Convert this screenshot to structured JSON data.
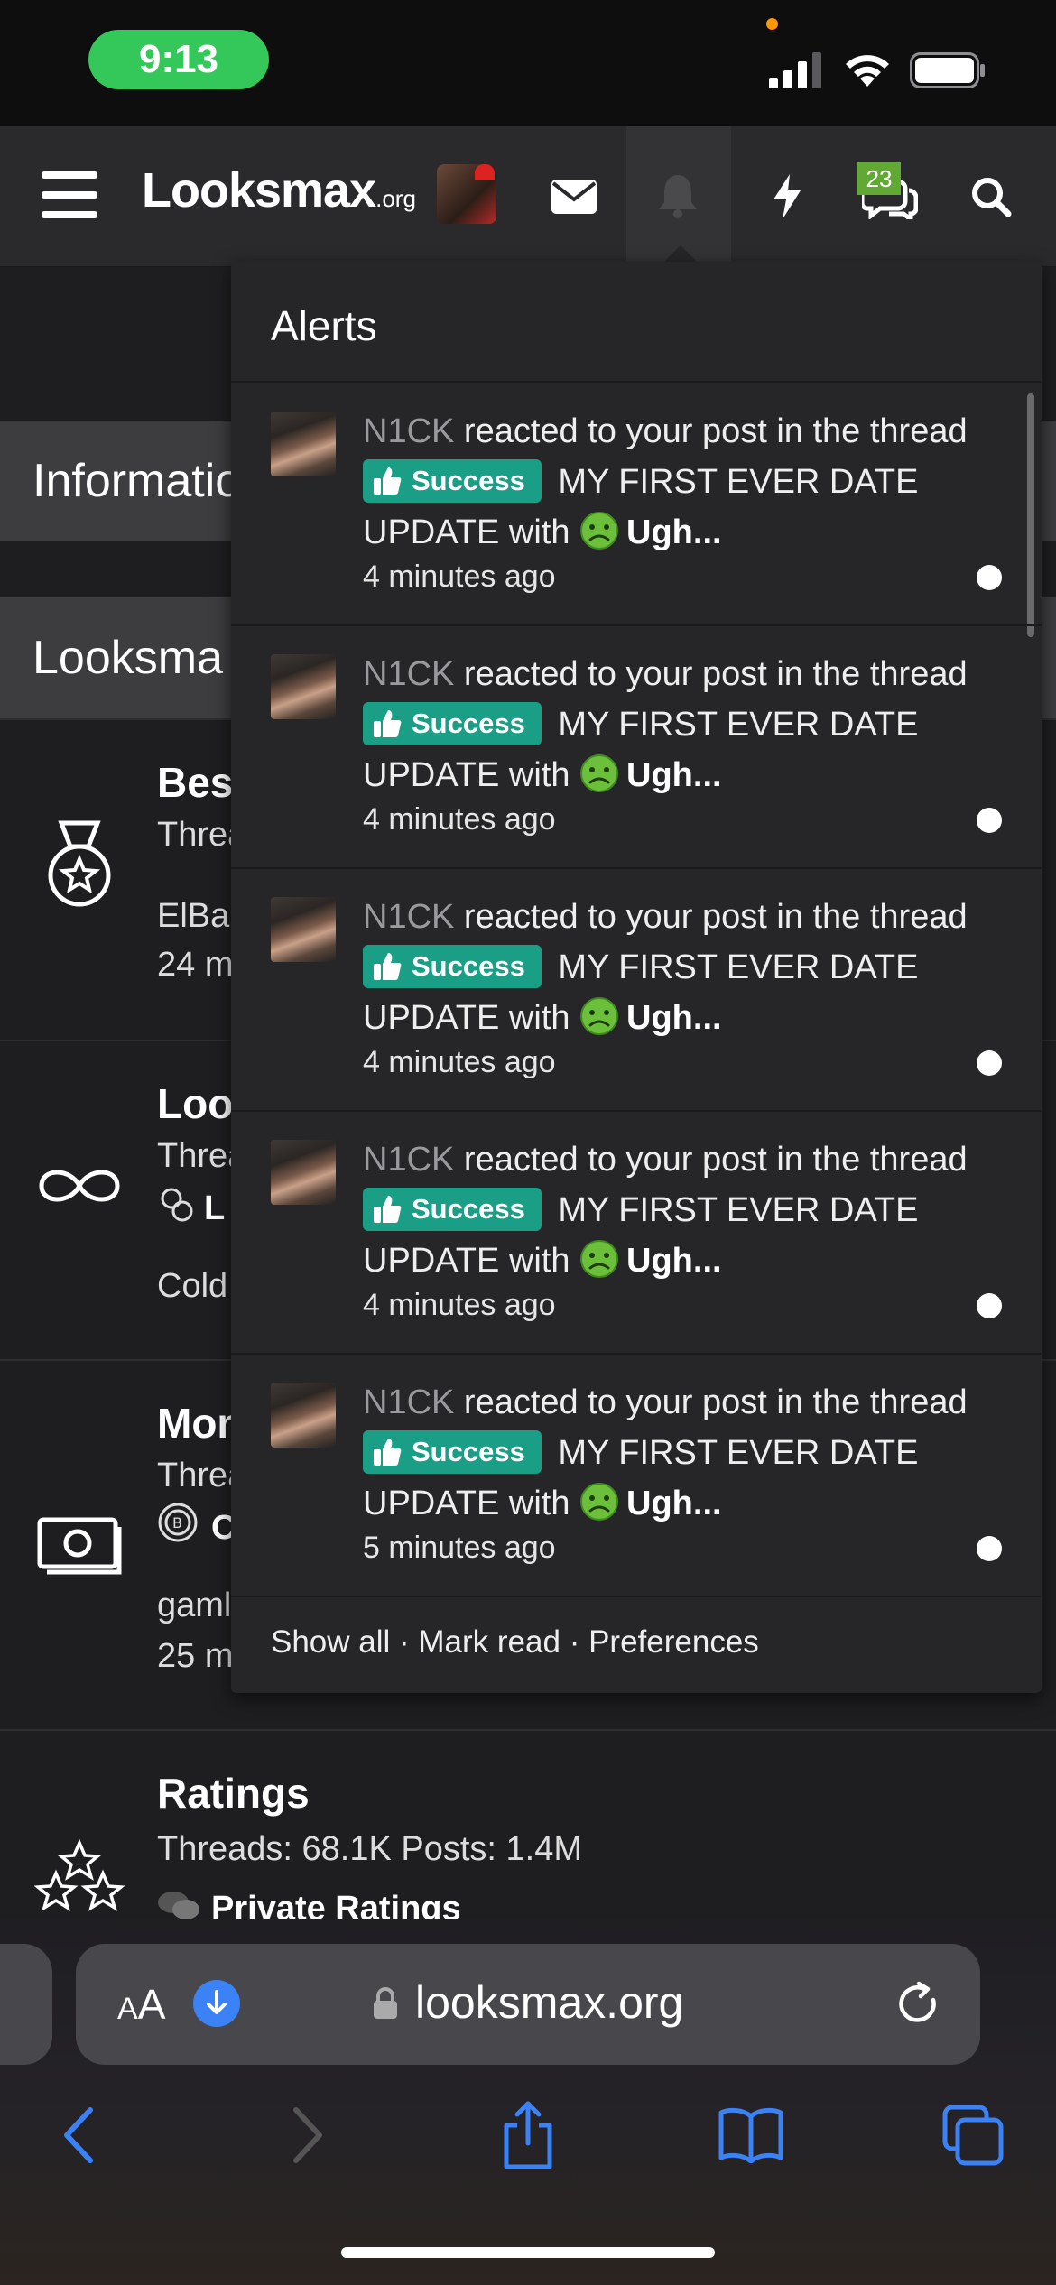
{
  "status_bar": {
    "time": "9:13"
  },
  "header": {
    "logo_main": "Looksmax",
    "logo_suffix": ".org",
    "conversations_badge": "23",
    "icons": [
      "menu-icon",
      "avatar",
      "mail-icon",
      "bell-icon",
      "lightning-icon",
      "chat-icon",
      "search-icon"
    ]
  },
  "page": {
    "bands": [
      "Informatio",
      "Looksma"
    ],
    "nodes": [
      {
        "title": "Bes",
        "line1": "Threa",
        "line2": "ElBa",
        "line3": "24 m"
      },
      {
        "title": "Loo",
        "line1": "Threa",
        "line2": "L",
        "line3": "Cold"
      },
      {
        "title": "Mon",
        "line1": "Threa",
        "line2": "C",
        "line3": "gaml",
        "line4": "25 m"
      },
      {
        "title": "Ratings",
        "line1": "Threads: 68.1K Posts: 1.4M",
        "line2": "Private Ratings"
      }
    ]
  },
  "alerts": {
    "title": "Alerts",
    "items": [
      {
        "user": "N1CK",
        "action": " reacted to your post in the thread ",
        "prefix": "Success",
        "thread": " MY FIRST EVER DATE UPDATE",
        "with": " with ",
        "reaction": "Ugh...",
        "time": "4 minutes ago"
      },
      {
        "user": "N1CK",
        "action": " reacted to your post in the thread ",
        "prefix": "Success",
        "thread": " MY FIRST EVER DATE UPDATE",
        "with": " with ",
        "reaction": "Ugh...",
        "time": "4 minutes ago"
      },
      {
        "user": "N1CK",
        "action": " reacted to your post in the thread ",
        "prefix": "Success",
        "thread": " MY FIRST EVER DATE UPDATE",
        "with": " with ",
        "reaction": "Ugh...",
        "time": "4 minutes ago"
      },
      {
        "user": "N1CK",
        "action": " reacted to your post in the thread ",
        "prefix": "Success",
        "thread": " MY FIRST EVER DATE UPDATE",
        "with": " with ",
        "reaction": "Ugh...",
        "time": "4 minutes ago"
      },
      {
        "user": "N1CK",
        "action": " reacted to your post in the thread ",
        "prefix": "Success",
        "thread": " MY FIRST EVER DATE UPDATE",
        "with": " with ",
        "reaction": "Ugh...",
        "time": "5 minutes ago"
      }
    ],
    "footer": {
      "show_all": "Show all",
      "sep": " · ",
      "mark_read": "Mark read",
      "preferences": "Preferences"
    }
  },
  "browser": {
    "aa_small": "A",
    "aa_large": "A",
    "url": "looksmax.org",
    "accent": "#3a82f6"
  },
  "colors": {
    "success_tag": "#1a9e86",
    "badge_green": "#62a834",
    "time_pill": "#34c759"
  }
}
